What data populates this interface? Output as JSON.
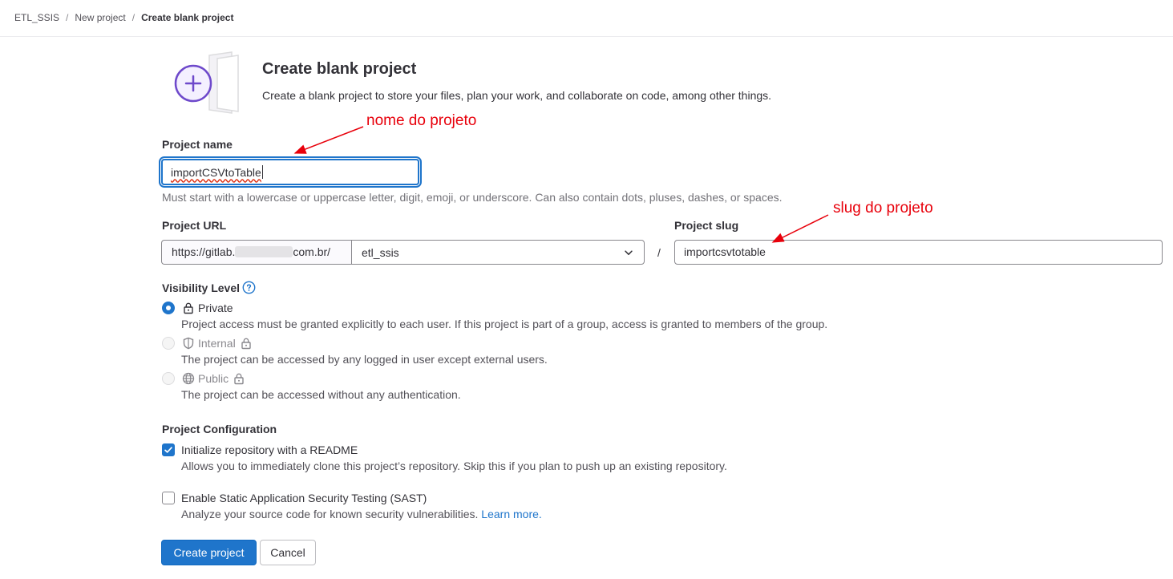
{
  "breadcrumb": {
    "items": [
      "ETL_SSIS",
      "New project",
      "Create blank project"
    ],
    "separator": "/"
  },
  "header": {
    "title": "Create blank project",
    "subtitle": "Create a blank project to store your files, plan your work, and collaborate on code, among other things."
  },
  "project_name": {
    "label": "Project name",
    "value": "importCSVtoTable",
    "help": "Must start with a lowercase or uppercase letter, digit, emoji, or underscore. Can also contain dots, pluses, dashes, or spaces."
  },
  "project_url": {
    "label": "Project URL",
    "prefix_start": "https://gitlab.",
    "prefix_end": "com.br/",
    "namespace": "etl_ssis",
    "separator": "/"
  },
  "project_slug": {
    "label": "Project slug",
    "value": "importcsvtotable"
  },
  "visibility": {
    "label": "Visibility Level",
    "options": [
      {
        "label": "Private",
        "description": "Project access must be granted explicitly to each user. If this project is part of a group, access is granted to members of the group.",
        "checked": true,
        "disabled": false
      },
      {
        "label": "Internal",
        "description": "The project can be accessed by any logged in user except external users.",
        "checked": false,
        "disabled": true
      },
      {
        "label": "Public",
        "description": "The project can be accessed without any authentication.",
        "checked": false,
        "disabled": true
      }
    ]
  },
  "configuration": {
    "label": "Project Configuration",
    "readme": {
      "label": "Initialize repository with a README",
      "description": "Allows you to immediately clone this project’s repository. Skip this if you plan to push up an existing repository.",
      "checked": true
    },
    "sast": {
      "label": "Enable Static Application Security Testing (SAST)",
      "description": "Analyze your source code for known security vulnerabilities.",
      "link": "Learn more.",
      "checked": false
    }
  },
  "actions": {
    "create": "Create project",
    "cancel": "Cancel"
  },
  "annotations": {
    "name_note": "nome do projeto",
    "slug_note": "slug do projeto"
  },
  "colors": {
    "accent": "#1f75cb",
    "annotation": "#e8000b",
    "illustration": "#6e49cb"
  }
}
